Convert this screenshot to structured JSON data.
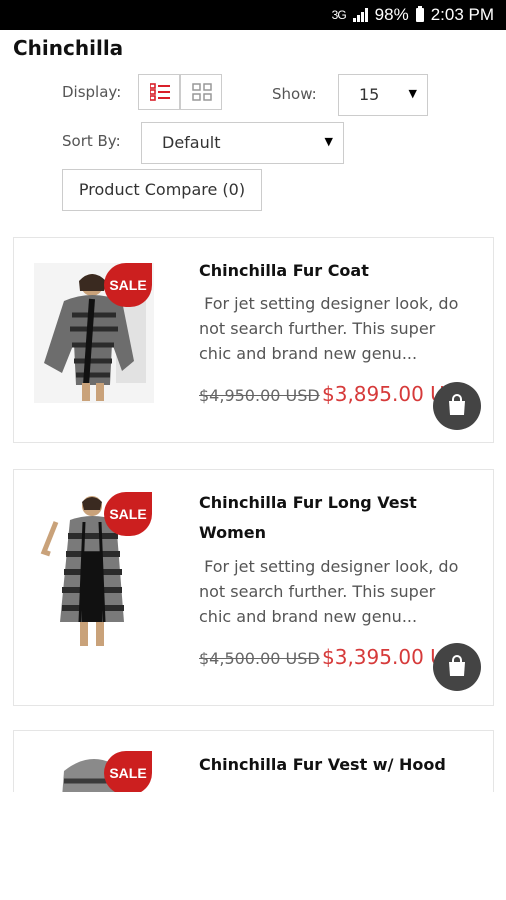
{
  "statusbar": {
    "network": "3G",
    "battery": "98%",
    "time": "2:03 PM"
  },
  "page": {
    "title": "Chinchilla"
  },
  "controls": {
    "display_label": "Display:",
    "show_label": "Show:",
    "show_value": "15",
    "sort_label": "Sort By:",
    "sort_value": "Default",
    "compare_label": "Product Compare (0)"
  },
  "products": [
    {
      "badge": "SALE",
      "name_line1": "Chinchilla Fur Coat",
      "name_line2": "",
      "desc_line1": " For jet setting designer look, do",
      "desc_line2": "not search further.  This super",
      "desc_line3": "chic and brand new genu...",
      "old_price": "$4,950.00 USD",
      "new_price": "$3,895.00 USD"
    },
    {
      "badge": "SALE",
      "name_line1": "Chinchilla Fur Long Vest",
      "name_line2": "Women",
      "desc_line1": " For jet setting designer look, do",
      "desc_line2": "not search further.  This super",
      "desc_line3": "chic and brand new genu...",
      "old_price": "$4,500.00 USD",
      "new_price": "$3,395.00 USD"
    },
    {
      "badge": "SALE",
      "name_line1": "Chinchilla Fur Vest w/ Hood",
      "name_line2": "..."
    }
  ],
  "icons": {
    "list": "list-view-icon",
    "grid": "grid-view-icon",
    "cart": "shopping-bag-icon"
  },
  "colors": {
    "sale_red": "#cc1f1f",
    "price_red": "#d63a3a",
    "accent_red": "#d9202a"
  }
}
